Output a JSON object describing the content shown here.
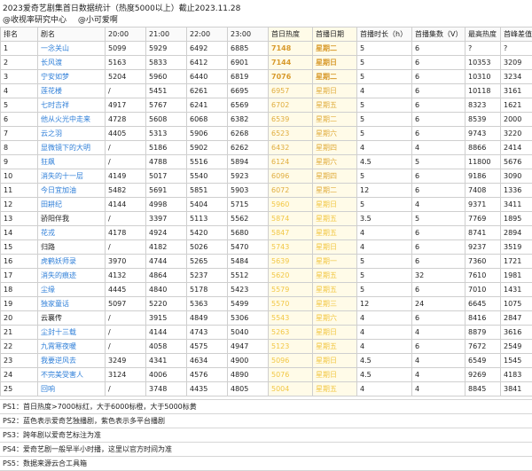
{
  "header": {
    "title": "2023爱奇艺剧集首日数据统计（热度5000以上）截止2023.11.28",
    "sources": [
      "@收视率研究中心",
      "@小可爱啊"
    ]
  },
  "columns": [
    "排名",
    "剧名",
    "20:00",
    "21:00",
    "22:00",
    "23:00",
    "首日热度",
    "首播日期",
    "首播时长（h）",
    "首播集数（V）",
    "最高热度",
    "首峰差值"
  ],
  "rows": [
    {
      "rank": "1",
      "name": "一念关山",
      "t20": "5099",
      "t21": "5929",
      "t22": "6492",
      "t23": "6885",
      "first": "7148",
      "date": "星期二",
      "hours": "5",
      "eps": "6",
      "max": "?",
      "diff": "?",
      "platform": "exclusive",
      "tier": "gold"
    },
    {
      "rank": "2",
      "name": "长风渡",
      "t20": "5163",
      "t21": "5833",
      "t22": "6412",
      "t23": "6901",
      "first": "7144",
      "date": "星期日",
      "hours": "5",
      "eps": "6",
      "max": "10353",
      "diff": "3209",
      "platform": "exclusive",
      "tier": "gold"
    },
    {
      "rank": "3",
      "name": "宁安如梦",
      "t20": "5204",
      "t21": "5960",
      "t22": "6440",
      "t23": "6819",
      "first": "7076",
      "date": "星期二",
      "hours": "5",
      "eps": "6",
      "max": "10310",
      "diff": "3234",
      "platform": "exclusive",
      "tier": "gold"
    },
    {
      "rank": "4",
      "name": "莲花楼",
      "t20": "/",
      "t21": "5451",
      "t22": "6261",
      "t23": "6695",
      "first": "6957",
      "date": "星期日",
      "hours": "4",
      "eps": "6",
      "max": "10118",
      "diff": "3161",
      "platform": "exclusive",
      "tier": "gold2"
    },
    {
      "rank": "5",
      "name": "七时吉祥",
      "t20": "4917",
      "t21": "5767",
      "t22": "6241",
      "t23": "6569",
      "first": "6702",
      "date": "星期五",
      "hours": "5",
      "eps": "6",
      "max": "8323",
      "diff": "1621",
      "platform": "exclusive",
      "tier": "gold2"
    },
    {
      "rank": "6",
      "name": "他从火光中走来",
      "t20": "4728",
      "t21": "5608",
      "t22": "6068",
      "t23": "6382",
      "first": "6539",
      "date": "星期二",
      "hours": "5",
      "eps": "6",
      "max": "8539",
      "diff": "2000",
      "platform": "exclusive",
      "tier": "gold2"
    },
    {
      "rank": "7",
      "name": "云之羽",
      "t20": "4405",
      "t21": "5313",
      "t22": "5906",
      "t23": "6268",
      "first": "6523",
      "date": "星期六",
      "hours": "5",
      "eps": "6",
      "max": "9743",
      "diff": "3220",
      "platform": "exclusive",
      "tier": "gold2"
    },
    {
      "rank": "8",
      "name": "显微镜下的大明",
      "t20": "/",
      "t21": "5186",
      "t22": "5902",
      "t23": "6262",
      "first": "6432",
      "date": "星期四",
      "hours": "4",
      "eps": "4",
      "max": "8866",
      "diff": "2414",
      "platform": "exclusive",
      "tier": "gold2"
    },
    {
      "rank": "9",
      "name": "狂飙",
      "t20": "/",
      "t21": "4788",
      "t22": "5516",
      "t23": "5894",
      "first": "6124",
      "date": "星期六",
      "hours": "4.5",
      "eps": "5",
      "max": "11800",
      "diff": "5676",
      "platform": "exclusive",
      "tier": "gold2"
    },
    {
      "rank": "10",
      "name": "消失的十一层",
      "t20": "4149",
      "t21": "5017",
      "t22": "5540",
      "t23": "5923",
      "first": "6096",
      "date": "星期四",
      "hours": "5",
      "eps": "6",
      "max": "9186",
      "diff": "3090",
      "platform": "exclusive",
      "tier": "gold2"
    },
    {
      "rank": "11",
      "name": "今日宜加油",
      "t20": "5482",
      "t21": "5691",
      "t22": "5851",
      "t23": "5903",
      "first": "6072",
      "date": "星期二",
      "hours": "12",
      "eps": "6",
      "max": "7408",
      "diff": "1336",
      "platform": "exclusive",
      "tier": "gold2"
    },
    {
      "rank": "12",
      "name": "田耕纪",
      "t20": "4144",
      "t21": "4998",
      "t22": "5404",
      "t23": "5715",
      "first": "5960",
      "date": "星期日",
      "hours": "5",
      "eps": "4",
      "max": "9371",
      "diff": "3411",
      "platform": "exclusive",
      "tier": "yellow"
    },
    {
      "rank": "13",
      "name": "骄阳伴我",
      "t20": "/",
      "t21": "3397",
      "t22": "5113",
      "t23": "5562",
      "first": "5874",
      "date": "星期五",
      "hours": "3.5",
      "eps": "5",
      "max": "7769",
      "diff": "1895",
      "platform": "multi",
      "tier": "yellow"
    },
    {
      "rank": "14",
      "name": "花戎",
      "t20": "4178",
      "t21": "4924",
      "t22": "5420",
      "t23": "5680",
      "first": "5847",
      "date": "星期五",
      "hours": "4",
      "eps": "6",
      "max": "8741",
      "diff": "2894",
      "platform": "exclusive",
      "tier": "yellow"
    },
    {
      "rank": "15",
      "name": "归路",
      "t20": "/",
      "t21": "4182",
      "t22": "5026",
      "t23": "5470",
      "first": "5743",
      "date": "星期日",
      "hours": "4",
      "eps": "6",
      "max": "9237",
      "diff": "3519",
      "platform": "multi",
      "tier": "yellow"
    },
    {
      "rank": "16",
      "name": "虎鹤妖师录",
      "t20": "3970",
      "t21": "4744",
      "t22": "5265",
      "t23": "5484",
      "first": "5639",
      "date": "星期一",
      "hours": "5",
      "eps": "6",
      "max": "7360",
      "diff": "1721",
      "platform": "exclusive",
      "tier": "yellow"
    },
    {
      "rank": "17",
      "name": "消失的痕迹",
      "t20": "4132",
      "t21": "4864",
      "t22": "5237",
      "t23": "5512",
      "first": "5620",
      "date": "星期五",
      "hours": "5",
      "eps": "32",
      "max": "7610",
      "diff": "1981",
      "platform": "exclusive",
      "tier": "yellow"
    },
    {
      "rank": "18",
      "name": "尘缘",
      "t20": "4445",
      "t21": "4840",
      "t22": "5178",
      "t23": "5423",
      "first": "5579",
      "date": "星期五",
      "hours": "5",
      "eps": "6",
      "max": "7010",
      "diff": "1431",
      "platform": "exclusive",
      "tier": "yellow"
    },
    {
      "rank": "19",
      "name": "独家童话",
      "t20": "5097",
      "t21": "5220",
      "t22": "5363",
      "t23": "5499",
      "first": "5570",
      "date": "星期三",
      "hours": "12",
      "eps": "24",
      "max": "6645",
      "diff": "1075",
      "platform": "exclusive",
      "tier": "yellow"
    },
    {
      "rank": "20",
      "name": "云襄传",
      "t20": "/",
      "t21": "3915",
      "t22": "4849",
      "t23": "5306",
      "first": "5543",
      "date": "星期六",
      "hours": "4",
      "eps": "6",
      "max": "8416",
      "diff": "2847",
      "platform": "multi",
      "tier": "yellow"
    },
    {
      "rank": "21",
      "name": "尘封十三载",
      "t20": "/",
      "t21": "4144",
      "t22": "4743",
      "t23": "5040",
      "first": "5263",
      "date": "星期日",
      "hours": "4",
      "eps": "4",
      "max": "8879",
      "diff": "3616",
      "platform": "exclusive",
      "tier": "yellow"
    },
    {
      "rank": "22",
      "name": "九霄寒夜暖",
      "t20": "/",
      "t21": "4058",
      "t22": "4575",
      "t23": "4947",
      "first": "5123",
      "date": "星期五",
      "hours": "4",
      "eps": "6",
      "max": "7672",
      "diff": "2549",
      "platform": "exclusive",
      "tier": "yellow"
    },
    {
      "rank": "23",
      "name": "我要逆风去",
      "t20": "3249",
      "t21": "4341",
      "t22": "4634",
      "t23": "4900",
      "first": "5096",
      "date": "星期日",
      "hours": "4.5",
      "eps": "4",
      "max": "6549",
      "diff": "1545",
      "platform": "exclusive",
      "tier": "yellow"
    },
    {
      "rank": "24",
      "name": "不完美受害人",
      "t20": "3124",
      "t21": "4006",
      "t22": "4576",
      "t23": "4890",
      "first": "5076",
      "date": "星期日",
      "hours": "4.5",
      "eps": "4",
      "max": "9269",
      "diff": "4183",
      "platform": "exclusive",
      "tier": "yellow"
    },
    {
      "rank": "25",
      "name": "回响",
      "t20": "/",
      "t21": "3748",
      "t22": "4435",
      "t23": "4805",
      "first": "5004",
      "date": "星期五",
      "hours": "4",
      "eps": "4",
      "max": "8845",
      "diff": "3841",
      "platform": "exclusive",
      "tier": "yellow"
    }
  ],
  "notes": [
    "PS1：首日热度>7000标红，大于6000标橙，大于5000标黄",
    "PS2：蓝色表示爱奇艺独播剧，紫色表示多平台播剧",
    "PS3：跨年剧以爱奇艺标注为准",
    "PS4：爱奇艺剧一般早半小时播，这里以官方时间为准",
    "PS5：数据来源云合工具箱"
  ],
  "colors": {
    "exclusive": "#2f7fd8",
    "multi": "#222222",
    "gold": "#d89a2c",
    "gold2": "#e0ad3e",
    "yellow": "#f2c744",
    "hot_bg": "#fffbe8"
  }
}
